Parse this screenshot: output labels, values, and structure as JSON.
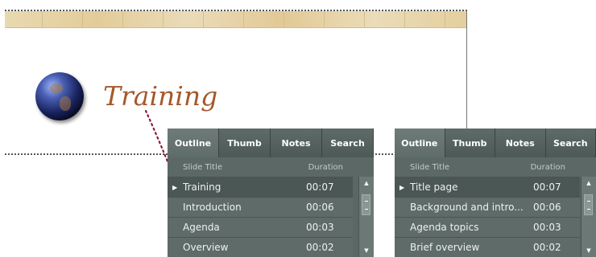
{
  "slide": {
    "title": "Training"
  },
  "panels": [
    {
      "tabs": [
        "Outline",
        "Thumb",
        "Notes",
        "Search"
      ],
      "active_tab": "Outline",
      "columns": {
        "title": "Slide Title",
        "duration": "Duration"
      },
      "rows": [
        {
          "title": "Training",
          "duration": "00:07",
          "selected": true
        },
        {
          "title": "Introduction",
          "duration": "00:06",
          "selected": false
        },
        {
          "title": "Agenda",
          "duration": "00:03",
          "selected": false
        },
        {
          "title": "Overview",
          "duration": "00:02",
          "selected": false
        }
      ]
    },
    {
      "tabs": [
        "Outline",
        "Thumb",
        "Notes",
        "Search"
      ],
      "active_tab": "Outline",
      "columns": {
        "title": "Slide Title",
        "duration": "Duration"
      },
      "rows": [
        {
          "title": "Title page",
          "duration": "00:07",
          "selected": true
        },
        {
          "title": "Background and intro...",
          "duration": "00:06",
          "selected": false
        },
        {
          "title": "Agenda topics",
          "duration": "00:03",
          "selected": false
        },
        {
          "title": "Brief overview",
          "duration": "00:02",
          "selected": false
        }
      ]
    }
  ],
  "colors": {
    "panel_bg": "#5a6765",
    "selected_row": "#4b5755",
    "title_text": "#a3592b",
    "connector": "#8b1a3a"
  },
  "icons": {
    "row_arrow": "right-triangle-icon",
    "scroll_up": "up-arrow-icon",
    "scroll_down": "down-arrow-icon",
    "globe": "globe-icon"
  }
}
